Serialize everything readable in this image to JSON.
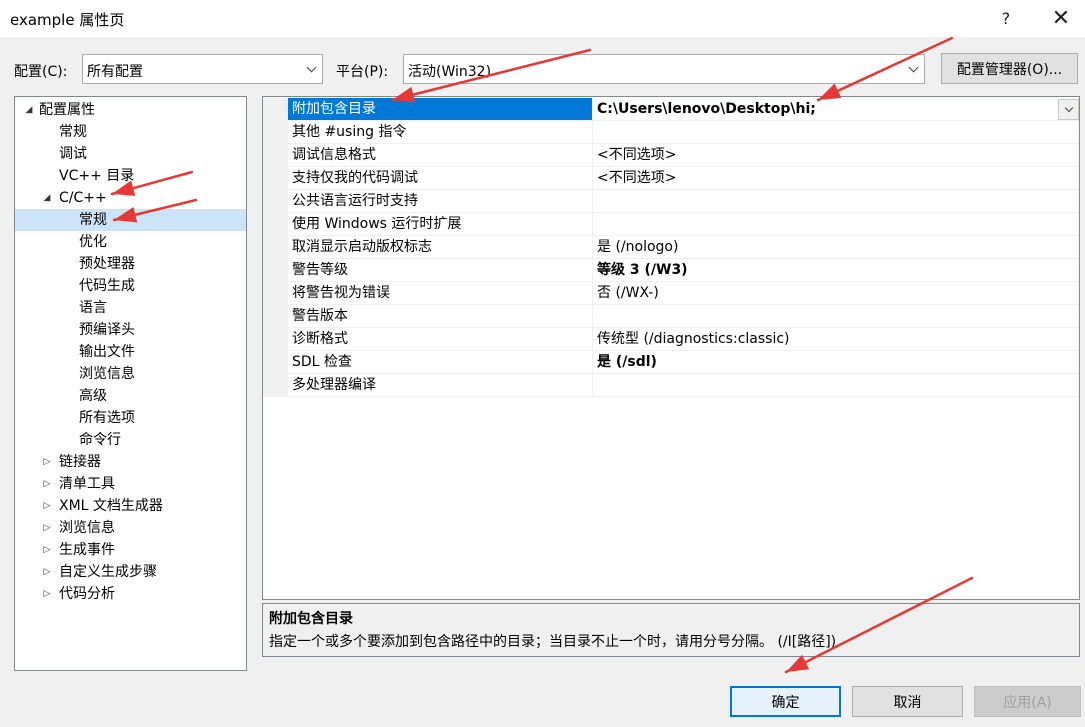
{
  "window": {
    "title": "example 属性页",
    "help_glyph": "?",
    "close_glyph": "✕"
  },
  "toolbar": {
    "config_label": "配置(C):",
    "config_value": "所有配置",
    "platform_label": "平台(P):",
    "platform_value": "活动(Win32)",
    "config_manager_button": "配置管理器(O)..."
  },
  "tree": {
    "items": [
      {
        "label": "配置属性",
        "expander": "◢",
        "selected": false
      },
      {
        "label": "常规",
        "expander": "",
        "selected": false
      },
      {
        "label": "调试",
        "expander": "",
        "selected": false
      },
      {
        "label": "VC++ 目录",
        "expander": "",
        "selected": false
      },
      {
        "label": "C/C++",
        "expander": "◢",
        "selected": false
      },
      {
        "label": "常规",
        "expander": "",
        "selected": true
      },
      {
        "label": "优化",
        "expander": "",
        "selected": false
      },
      {
        "label": "预处理器",
        "expander": "",
        "selected": false
      },
      {
        "label": "代码生成",
        "expander": "",
        "selected": false
      },
      {
        "label": "语言",
        "expander": "",
        "selected": false
      },
      {
        "label": "预编译头",
        "expander": "",
        "selected": false
      },
      {
        "label": "输出文件",
        "expander": "",
        "selected": false
      },
      {
        "label": "浏览信息",
        "expander": "",
        "selected": false
      },
      {
        "label": "高级",
        "expander": "",
        "selected": false
      },
      {
        "label": "所有选项",
        "expander": "",
        "selected": false
      },
      {
        "label": "命令行",
        "expander": "",
        "selected": false
      },
      {
        "label": "链接器",
        "expander": "▷",
        "selected": false
      },
      {
        "label": "清单工具",
        "expander": "▷",
        "selected": false
      },
      {
        "label": "XML 文档生成器",
        "expander": "▷",
        "selected": false
      },
      {
        "label": "浏览信息",
        "expander": "▷",
        "selected": false
      },
      {
        "label": "生成事件",
        "expander": "▷",
        "selected": false
      },
      {
        "label": "自定义生成步骤",
        "expander": "▷",
        "selected": false
      },
      {
        "label": "代码分析",
        "expander": "▷",
        "selected": false
      }
    ]
  },
  "properties": [
    {
      "name": "附加包含目录",
      "value": "C:\\Users\\lenovo\\Desktop\\hi;",
      "bold": true,
      "selected": true
    },
    {
      "name": "其他 #using 指令",
      "value": "",
      "bold": false,
      "selected": false
    },
    {
      "name": "调试信息格式",
      "value": "<不同选项>",
      "bold": false,
      "selected": false
    },
    {
      "name": "支持仅我的代码调试",
      "value": "<不同选项>",
      "bold": false,
      "selected": false
    },
    {
      "name": "公共语言运行时支持",
      "value": "",
      "bold": false,
      "selected": false
    },
    {
      "name": "使用 Windows 运行时扩展",
      "value": "",
      "bold": false,
      "selected": false
    },
    {
      "name": "取消显示启动版权标志",
      "value": "是 (/nologo)",
      "bold": false,
      "selected": false
    },
    {
      "name": "警告等级",
      "value": "等级 3 (/W3)",
      "bold": true,
      "selected": false
    },
    {
      "name": "将警告视为错误",
      "value": "否 (/WX-)",
      "bold": false,
      "selected": false
    },
    {
      "name": "警告版本",
      "value": "",
      "bold": false,
      "selected": false
    },
    {
      "name": "诊断格式",
      "value": "传统型 (/diagnostics:classic)",
      "bold": false,
      "selected": false
    },
    {
      "name": "SDL 检查",
      "value": "是 (/sdl)",
      "bold": true,
      "selected": false
    },
    {
      "name": "多处理器编译",
      "value": "",
      "bold": false,
      "selected": false
    }
  ],
  "description": {
    "title": "附加包含目录",
    "text": "指定一个或多个要添加到包含路径中的目录；当目录不止一个时，请用分号分隔。     (/I[路径])"
  },
  "buttons": {
    "ok": "确定",
    "cancel": "取消",
    "apply": "应用(A)"
  },
  "colors": {
    "selection": "#0078d7",
    "tree_selection": "#cce4f7",
    "annotation_arrow": "#e53935"
  }
}
